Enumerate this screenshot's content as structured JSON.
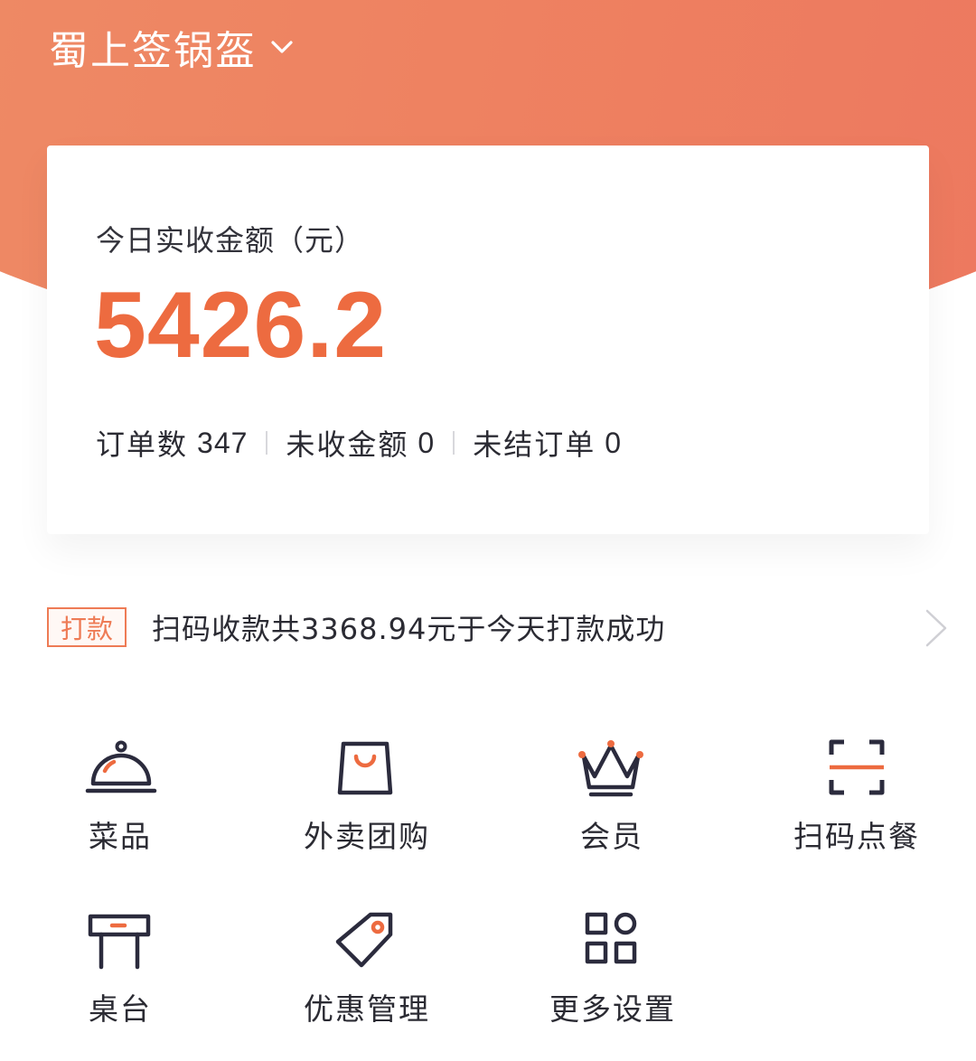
{
  "header": {
    "store_name": "蜀上签锅盔",
    "icon": "chevron-down-icon"
  },
  "summary": {
    "revenue_label": "今日实收金额（元）",
    "revenue_value": "5426.2",
    "stats": [
      {
        "label": "订单数",
        "value": "347"
      },
      {
        "label": "未收金额",
        "value": "0"
      },
      {
        "label": "未结订单",
        "value": "0"
      }
    ]
  },
  "notice": {
    "tag": "打款",
    "text": "扫码收款共3368.94元于今天打款成功",
    "icon": "chevron-right-icon"
  },
  "menu": [
    {
      "label": "菜品",
      "icon": "dish-cover-icon"
    },
    {
      "label": "外卖团购",
      "icon": "shopping-bag-icon"
    },
    {
      "label": "会员",
      "icon": "crown-icon"
    },
    {
      "label": "扫码点餐",
      "icon": "scan-icon"
    },
    {
      "label": "桌台",
      "icon": "table-icon"
    },
    {
      "label": "优惠管理",
      "icon": "price-tag-icon"
    },
    {
      "label": "更多设置",
      "icon": "grid-apps-icon"
    }
  ],
  "colors": {
    "brand_gradient_start": "#ef9068",
    "brand_gradient_end": "#ec735e",
    "accent": "#ed6b40",
    "icon_stroke": "#2b2b3d"
  }
}
